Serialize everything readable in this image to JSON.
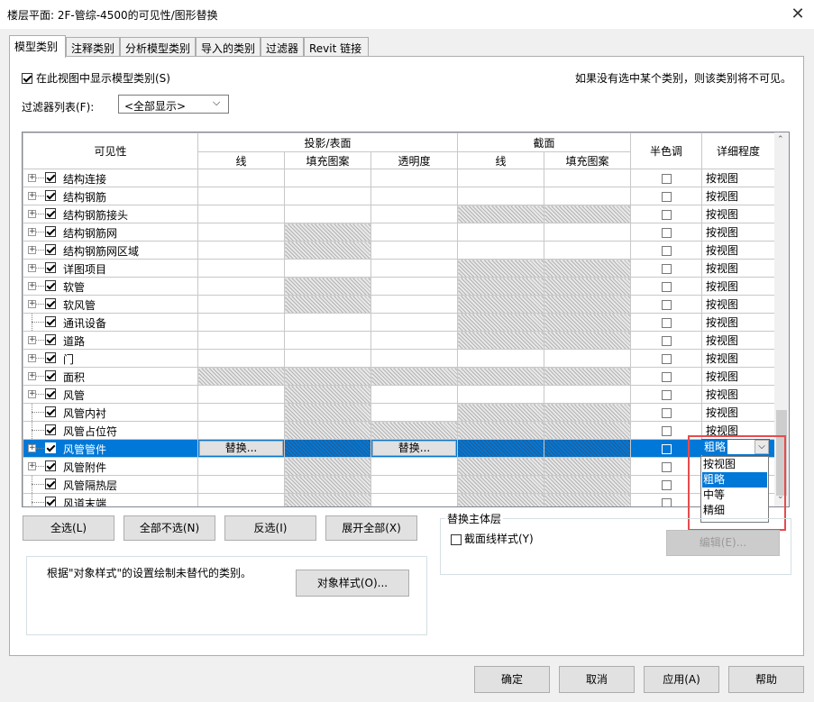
{
  "window": {
    "title": "楼层平面: 2F-管综-4500的可见性/图形替换",
    "close_glyph": "✕"
  },
  "tabs": [
    "模型类别",
    "注释类别",
    "分析模型类别",
    "导入的类别",
    "过滤器",
    "Revit 链接"
  ],
  "show_model_categories": {
    "label": "在此视图中显示模型类别(S)",
    "checked": true
  },
  "hint": "如果没有选中某个类别，则该类别将不可见。",
  "filter_list": {
    "label": "过滤器列表(F):",
    "value": "<全部显示>"
  },
  "grid": {
    "headers": {
      "visibility": "可见性",
      "projection_surface": "投影/表面",
      "section": "截面",
      "halftone": "半色调",
      "detail_level": "详细程度",
      "line": "线",
      "fill_pattern": "填充图案",
      "transparency": "透明度",
      "section_line": "线",
      "section_fill": "填充图案"
    },
    "rows": [
      {
        "name": "结构连接",
        "expand": true,
        "detail": "按视图",
        "hatch": [
          0,
          0,
          0,
          0,
          0
        ]
      },
      {
        "name": "结构钢筋",
        "expand": true,
        "detail": "按视图",
        "hatch": [
          0,
          0,
          0,
          0,
          0
        ]
      },
      {
        "name": "结构钢筋接头",
        "expand": true,
        "detail": "按视图",
        "hatch": [
          0,
          0,
          0,
          1,
          1
        ]
      },
      {
        "name": "结构钢筋网",
        "expand": true,
        "detail": "按视图",
        "hatch": [
          0,
          1,
          0,
          0,
          0
        ]
      },
      {
        "name": "结构钢筋网区域",
        "expand": true,
        "detail": "按视图",
        "hatch": [
          0,
          1,
          0,
          0,
          0
        ]
      },
      {
        "name": "详图项目",
        "expand": true,
        "detail": "按视图",
        "hatch": [
          0,
          0,
          0,
          1,
          1
        ]
      },
      {
        "name": "软管",
        "expand": true,
        "detail": "按视图",
        "hatch": [
          0,
          1,
          0,
          1,
          1
        ]
      },
      {
        "name": "软风管",
        "expand": true,
        "detail": "按视图",
        "hatch": [
          0,
          1,
          0,
          1,
          1
        ]
      },
      {
        "name": "通讯设备",
        "expand": false,
        "detail": "按视图",
        "hatch": [
          0,
          0,
          0,
          1,
          1
        ]
      },
      {
        "name": "道路",
        "expand": true,
        "detail": "按视图",
        "hatch": [
          0,
          0,
          0,
          1,
          1
        ]
      },
      {
        "name": "门",
        "expand": true,
        "detail": "按视图",
        "hatch": [
          0,
          0,
          0,
          0,
          0
        ]
      },
      {
        "name": "面积",
        "expand": true,
        "detail": "按视图",
        "hatch": [
          1,
          1,
          1,
          1,
          1
        ]
      },
      {
        "name": "风管",
        "expand": true,
        "detail": "按视图",
        "hatch": [
          0,
          1,
          0,
          0,
          0
        ]
      },
      {
        "name": "风管内衬",
        "expand": false,
        "detail": "按视图",
        "hatch": [
          0,
          1,
          0,
          1,
          1
        ]
      },
      {
        "name": "风管占位符",
        "expand": false,
        "detail": "按视图",
        "hatch": [
          0,
          1,
          1,
          1,
          1
        ]
      },
      {
        "name": "风管管件",
        "expand": true,
        "detail": "粗略",
        "hatch": [
          0,
          1,
          0,
          1,
          1
        ],
        "selected": true,
        "replace_label": "替换..."
      },
      {
        "name": "风管附件",
        "expand": true,
        "detail": "按视图",
        "hatch": [
          0,
          1,
          0,
          1,
          1
        ]
      },
      {
        "name": "风管隔热层",
        "expand": false,
        "detail": "按视图",
        "hatch": [
          0,
          1,
          0,
          1,
          1
        ]
      },
      {
        "name": "风道末端",
        "expand": false,
        "detail": "按视图",
        "hatch": [
          0,
          1,
          0,
          1,
          1
        ]
      }
    ],
    "dropdown": {
      "value": "粗略",
      "options": [
        "按视图",
        "粗略",
        "中等",
        "精细"
      ],
      "highlighted": 1
    }
  },
  "buttons": {
    "select_all": "全选(L)",
    "select_none": "全部不选(N)",
    "invert": "反选(I)",
    "expand_all": "展开全部(X)",
    "object_styles": "对象样式(O)...",
    "edit": "编辑(E)...",
    "ok": "确定",
    "cancel": "取消",
    "apply": "应用(A)",
    "help": "帮助"
  },
  "host_layer": {
    "group_label": "替换主体层",
    "cut_line_label": "截面线样式(Y)",
    "checked": false
  },
  "object_styles_note": "根据\"对象样式\"的设置绘制未替代的类别。"
}
